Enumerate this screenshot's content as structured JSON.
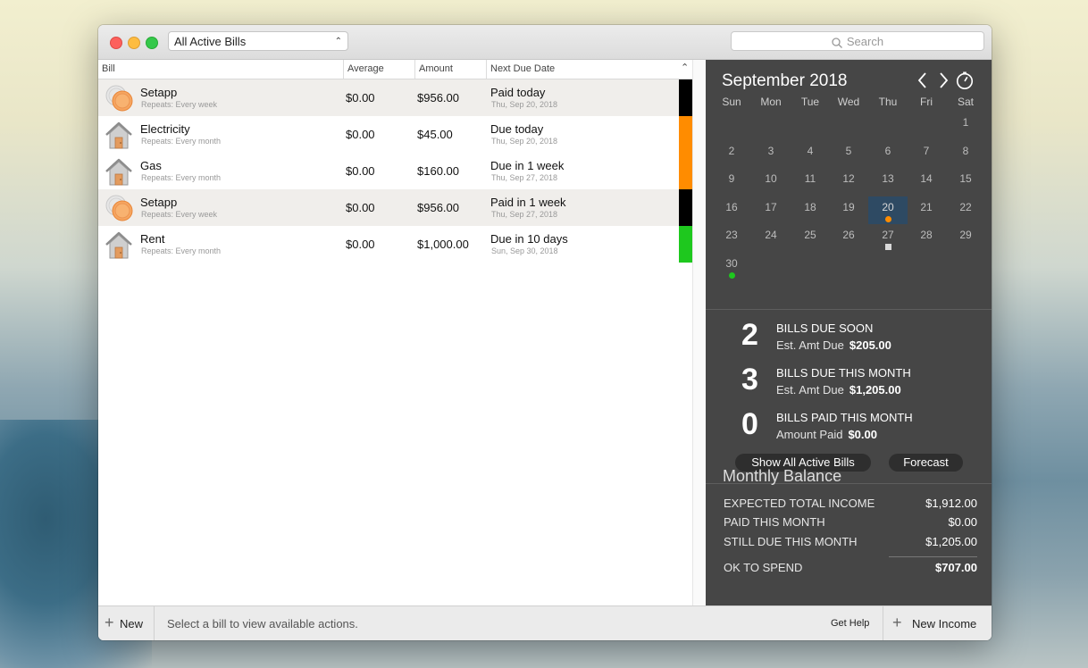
{
  "toolbar": {
    "filter_value": "All Active Bills",
    "search_placeholder": "Search"
  },
  "columns": [
    "Bill",
    "Average",
    "Amount",
    "Next Due Date"
  ],
  "bills": [
    {
      "name": "Setapp",
      "repeats": "Repeats: Every week",
      "average": "$0.00",
      "amount": "$956.00",
      "due": "Paid today",
      "date": "Thu, Sep 20, 2018",
      "icon": "coins-icon",
      "status_color": "#000000",
      "shaded": true
    },
    {
      "name": "Electricity",
      "repeats": "Repeats: Every month",
      "average": "$0.00",
      "amount": "$45.00",
      "due": "Due today",
      "date": "Thu, Sep 20, 2018",
      "icon": "house-icon",
      "status_color": "#ff8c00",
      "shaded": false
    },
    {
      "name": "Gas",
      "repeats": "Repeats: Every month",
      "average": "$0.00",
      "amount": "$160.00",
      "due": "Due in 1 week",
      "date": "Thu, Sep 27, 2018",
      "icon": "house-icon",
      "status_color": "#ff8c00",
      "shaded": false
    },
    {
      "name": "Setapp",
      "repeats": "Repeats: Every week",
      "average": "$0.00",
      "amount": "$956.00",
      "due": "Paid in 1 week",
      "date": "Thu, Sep 27, 2018",
      "icon": "coins-icon",
      "status_color": "#000000",
      "shaded": true
    },
    {
      "name": "Rent",
      "repeats": "Repeats: Every month",
      "average": "$0.00",
      "amount": "$1,000.00",
      "due": "Due in 10 days",
      "date": "Sun, Sep 30, 2018",
      "icon": "house-icon",
      "status_color": "#1ec81e",
      "shaded": false
    }
  ],
  "calendar": {
    "title": "September 2018",
    "weekdays": [
      "Sun",
      "Mon",
      "Tue",
      "Wed",
      "Thu",
      "Fri",
      "Sat"
    ],
    "first_weekday_index": 6,
    "days_in_month": 30,
    "today": 20,
    "markers": [
      {
        "day": 20,
        "color": "#ff8c00",
        "shape": "dot"
      },
      {
        "day": 27,
        "color": "#d9d9d9",
        "shape": "square"
      },
      {
        "day": 30,
        "color": "#1ec81e",
        "shape": "dot"
      }
    ]
  },
  "stats": [
    {
      "count": "2",
      "label": "BILLS DUE SOON",
      "sub_label": "Est. Amt Due",
      "sub_value": "$205.00"
    },
    {
      "count": "3",
      "label": "BILLS DUE THIS MONTH",
      "sub_label": "Est. Amt Due",
      "sub_value": "$1,205.00"
    },
    {
      "count": "0",
      "label": "BILLS PAID THIS MONTH",
      "sub_label": "Amount Paid",
      "sub_value": "$0.00"
    }
  ],
  "buttons": {
    "show_all": "Show All Active Bills",
    "forecast": "Forecast"
  },
  "monthly_balance": {
    "title": "Monthly Balance",
    "rows": [
      {
        "label": "EXPECTED TOTAL INCOME",
        "value": "$1,912.00"
      },
      {
        "label": "PAID THIS MONTH",
        "value": "$0.00"
      },
      {
        "label": "STILL DUE THIS MONTH",
        "value": "$1,205.00"
      }
    ],
    "ok_label": "OK TO SPEND",
    "ok_value": "$707.00"
  },
  "footer": {
    "new_label": "New",
    "status": "Select a bill to view available actions.",
    "help": "Get Help",
    "income_label": "New Income"
  }
}
